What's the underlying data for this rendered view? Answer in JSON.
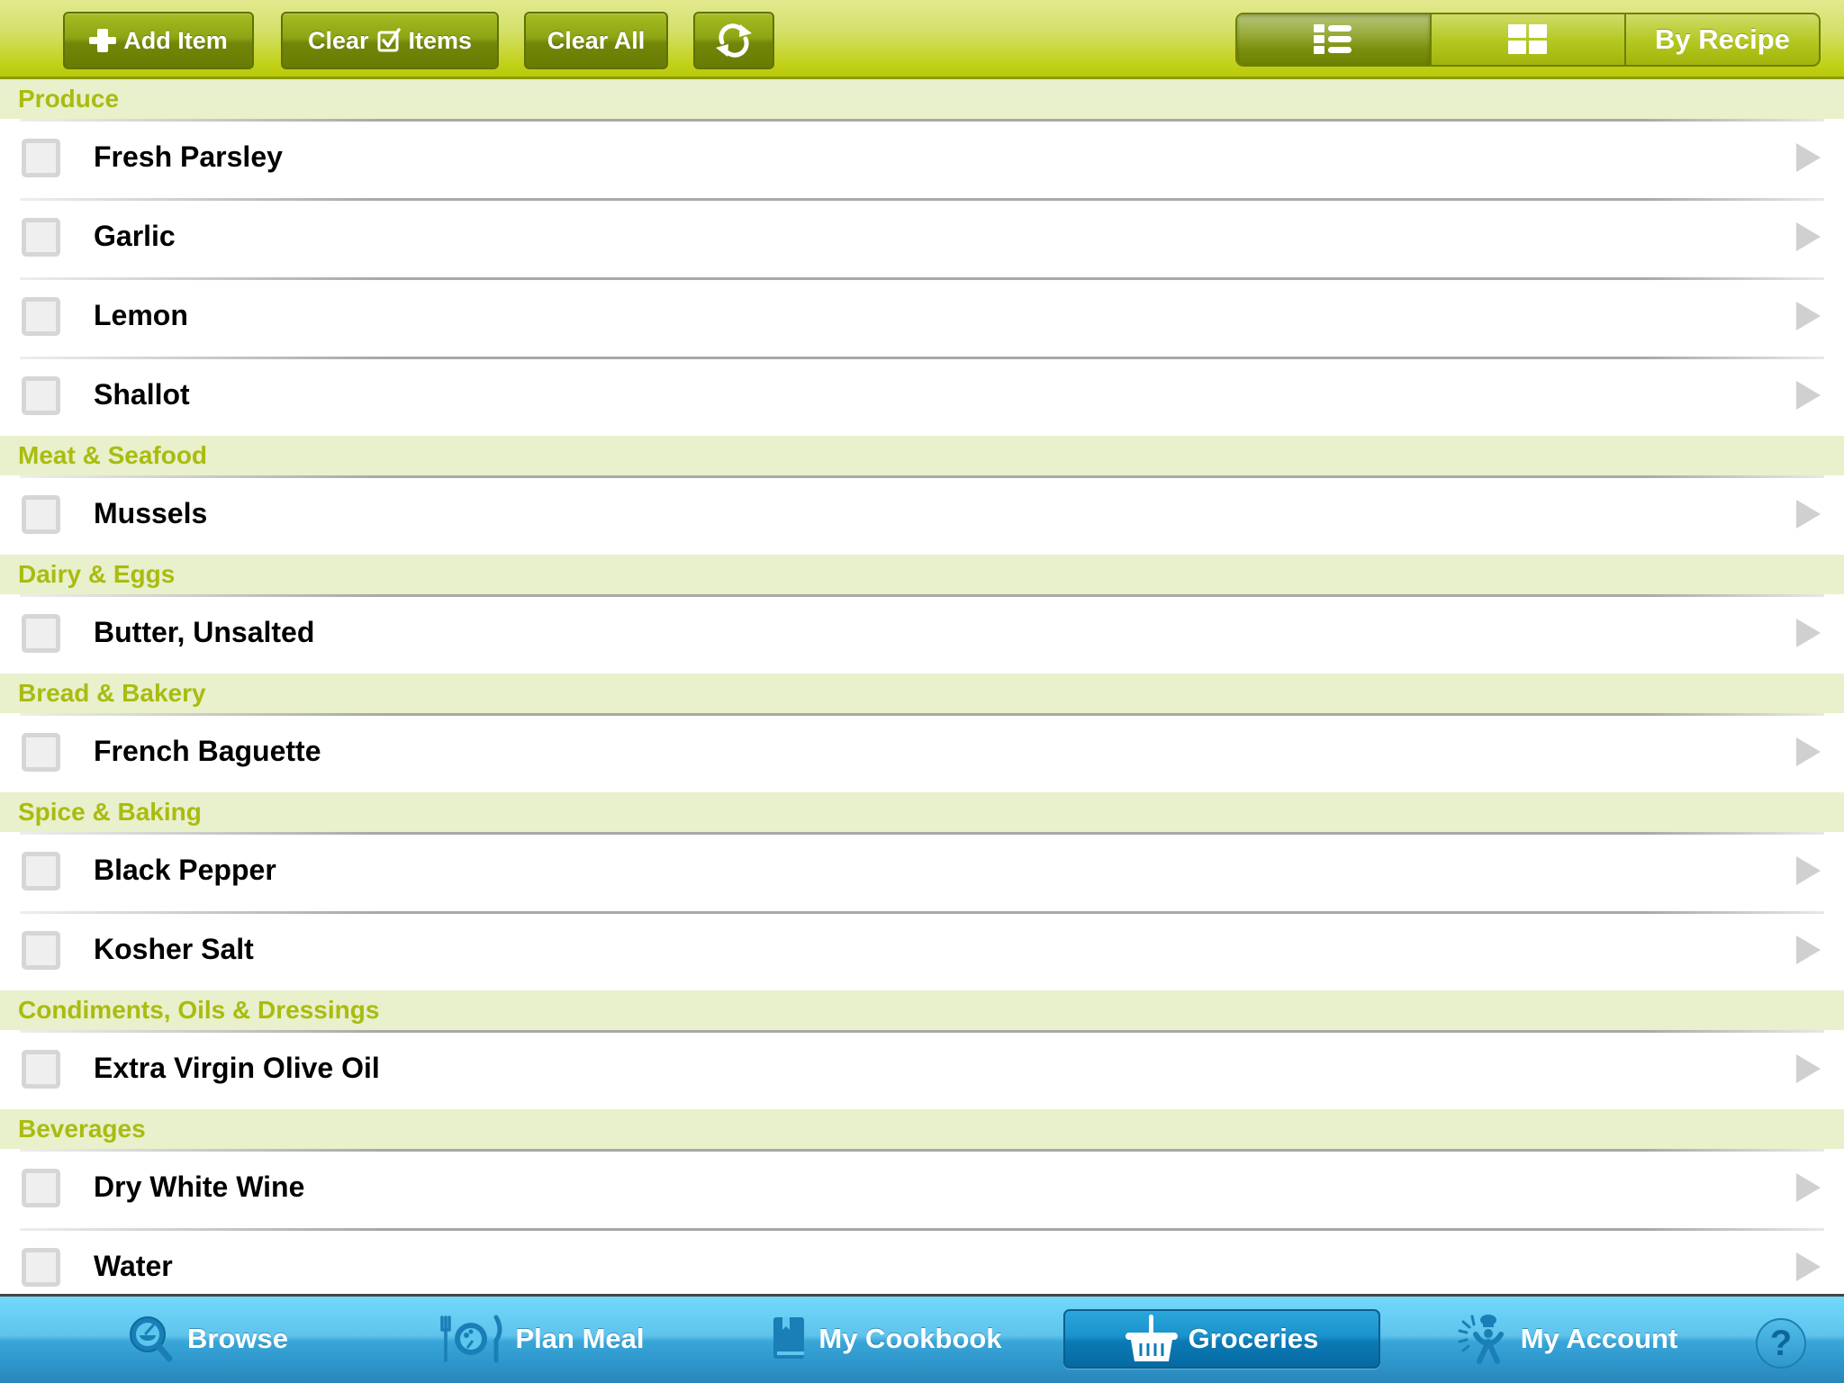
{
  "toolbar": {
    "add_item_label": "Add Item",
    "clear_checked_label_before": "Clear",
    "clear_checked_label_after": "Items",
    "clear_all_label": "Clear All",
    "refresh_icon": "refresh-icon",
    "view_toggle": {
      "list_icon": "list-view-icon",
      "grid_icon": "grid-view-icon",
      "by_recipe_label": "By Recipe",
      "selected": "list"
    }
  },
  "colors": {
    "toolbar_accent": "#b8c90a",
    "section_header_bg": "#e9f0cc",
    "section_header_text": "#a9bc0f",
    "tabbar_blue": "#2f97cc",
    "selected_tab": "#0c7ab5"
  },
  "sections": [
    {
      "title": "Produce",
      "items": [
        {
          "name": "Fresh Parsley",
          "checked": false
        },
        {
          "name": "Garlic",
          "checked": false
        },
        {
          "name": "Lemon",
          "checked": false
        },
        {
          "name": "Shallot",
          "checked": false
        }
      ]
    },
    {
      "title": "Meat & Seafood",
      "items": [
        {
          "name": "Mussels",
          "checked": false
        }
      ]
    },
    {
      "title": "Dairy & Eggs",
      "items": [
        {
          "name": "Butter, Unsalted",
          "checked": false
        }
      ]
    },
    {
      "title": "Bread & Bakery",
      "items": [
        {
          "name": "French Baguette",
          "checked": false
        }
      ]
    },
    {
      "title": "Spice & Baking",
      "items": [
        {
          "name": "Black Pepper",
          "checked": false
        },
        {
          "name": "Kosher Salt",
          "checked": false
        }
      ]
    },
    {
      "title": "Condiments, Oils & Dressings",
      "items": [
        {
          "name": "Extra Virgin Olive Oil",
          "checked": false
        }
      ]
    },
    {
      "title": "Beverages",
      "items": [
        {
          "name": "Dry White Wine",
          "checked": false
        },
        {
          "name": "Water",
          "checked": false
        }
      ]
    }
  ],
  "tabbar": {
    "tabs": [
      {
        "label": "Browse",
        "icon": "browse-search-icon",
        "selected": false
      },
      {
        "label": "Plan Meal",
        "icon": "plan-meal-plate-icon",
        "selected": false
      },
      {
        "label": "My Cookbook",
        "icon": "cookbook-icon",
        "selected": false
      },
      {
        "label": "Groceries",
        "icon": "basket-icon",
        "selected": true
      },
      {
        "label": "My Account",
        "icon": "chef-account-icon",
        "selected": false
      }
    ],
    "help_label": "?"
  }
}
